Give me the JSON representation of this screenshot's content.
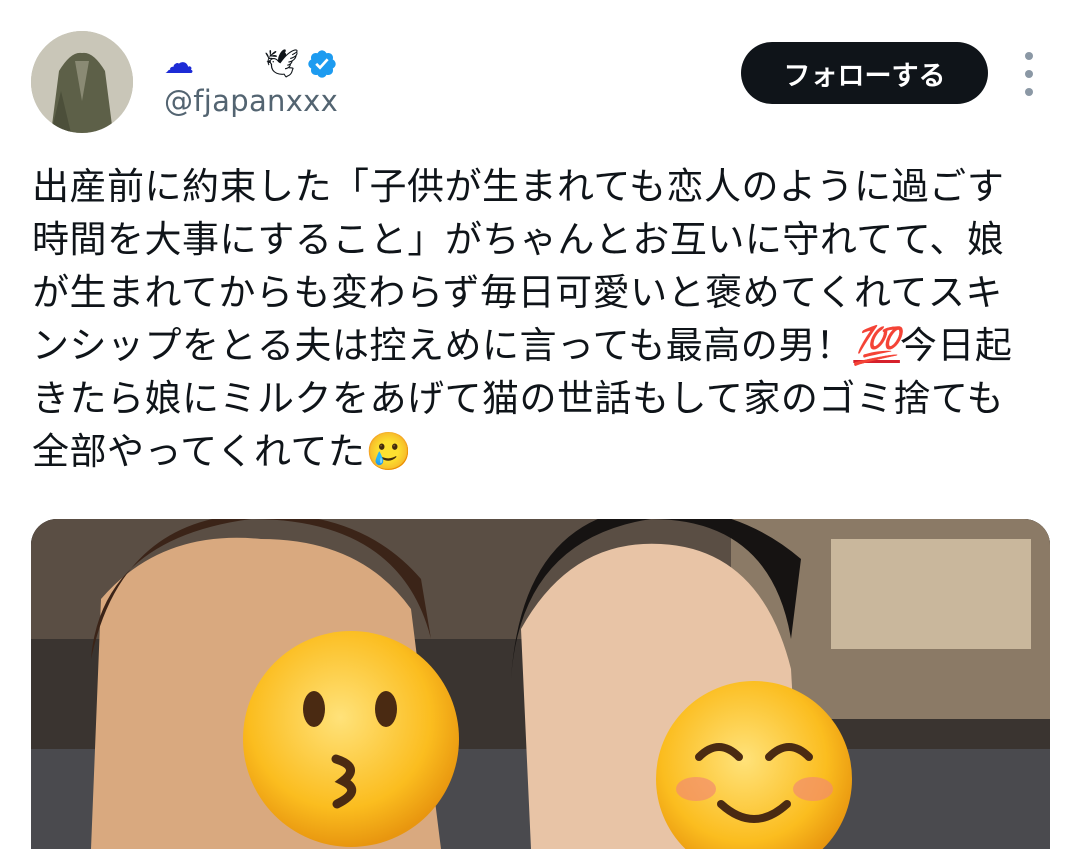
{
  "user": {
    "name_emoji_left": "☁",
    "name_emoji_right": "🕊",
    "handle": "@fjapanxxx",
    "verified": true
  },
  "follow_button": {
    "label": "フォローする"
  },
  "tweet": {
    "text_before_emoji": "出産前に約束した「子供が生まれても恋人のように過ごす時間を大事にすること」がちゃんとお互いに守れてて、娘が生まれてからも変わらず毎日可愛いと褒めてくれてスキンシップをとる夫は控えめに言っても最高の男！",
    "emoji_100": "💯",
    "text_after_emoji": "今日起きたら娘にミルクをあげて猫の世話もして家のゴミ捨ても全部やってくれてた",
    "emoji_end": "🥲"
  },
  "colors": {
    "text": "#0f1419",
    "handle": "#536471",
    "button_bg": "#0f1419",
    "verified": "#1d9bf0"
  },
  "icons": {
    "verified": "verified-badge-icon",
    "more": "more-vertical-icon"
  }
}
